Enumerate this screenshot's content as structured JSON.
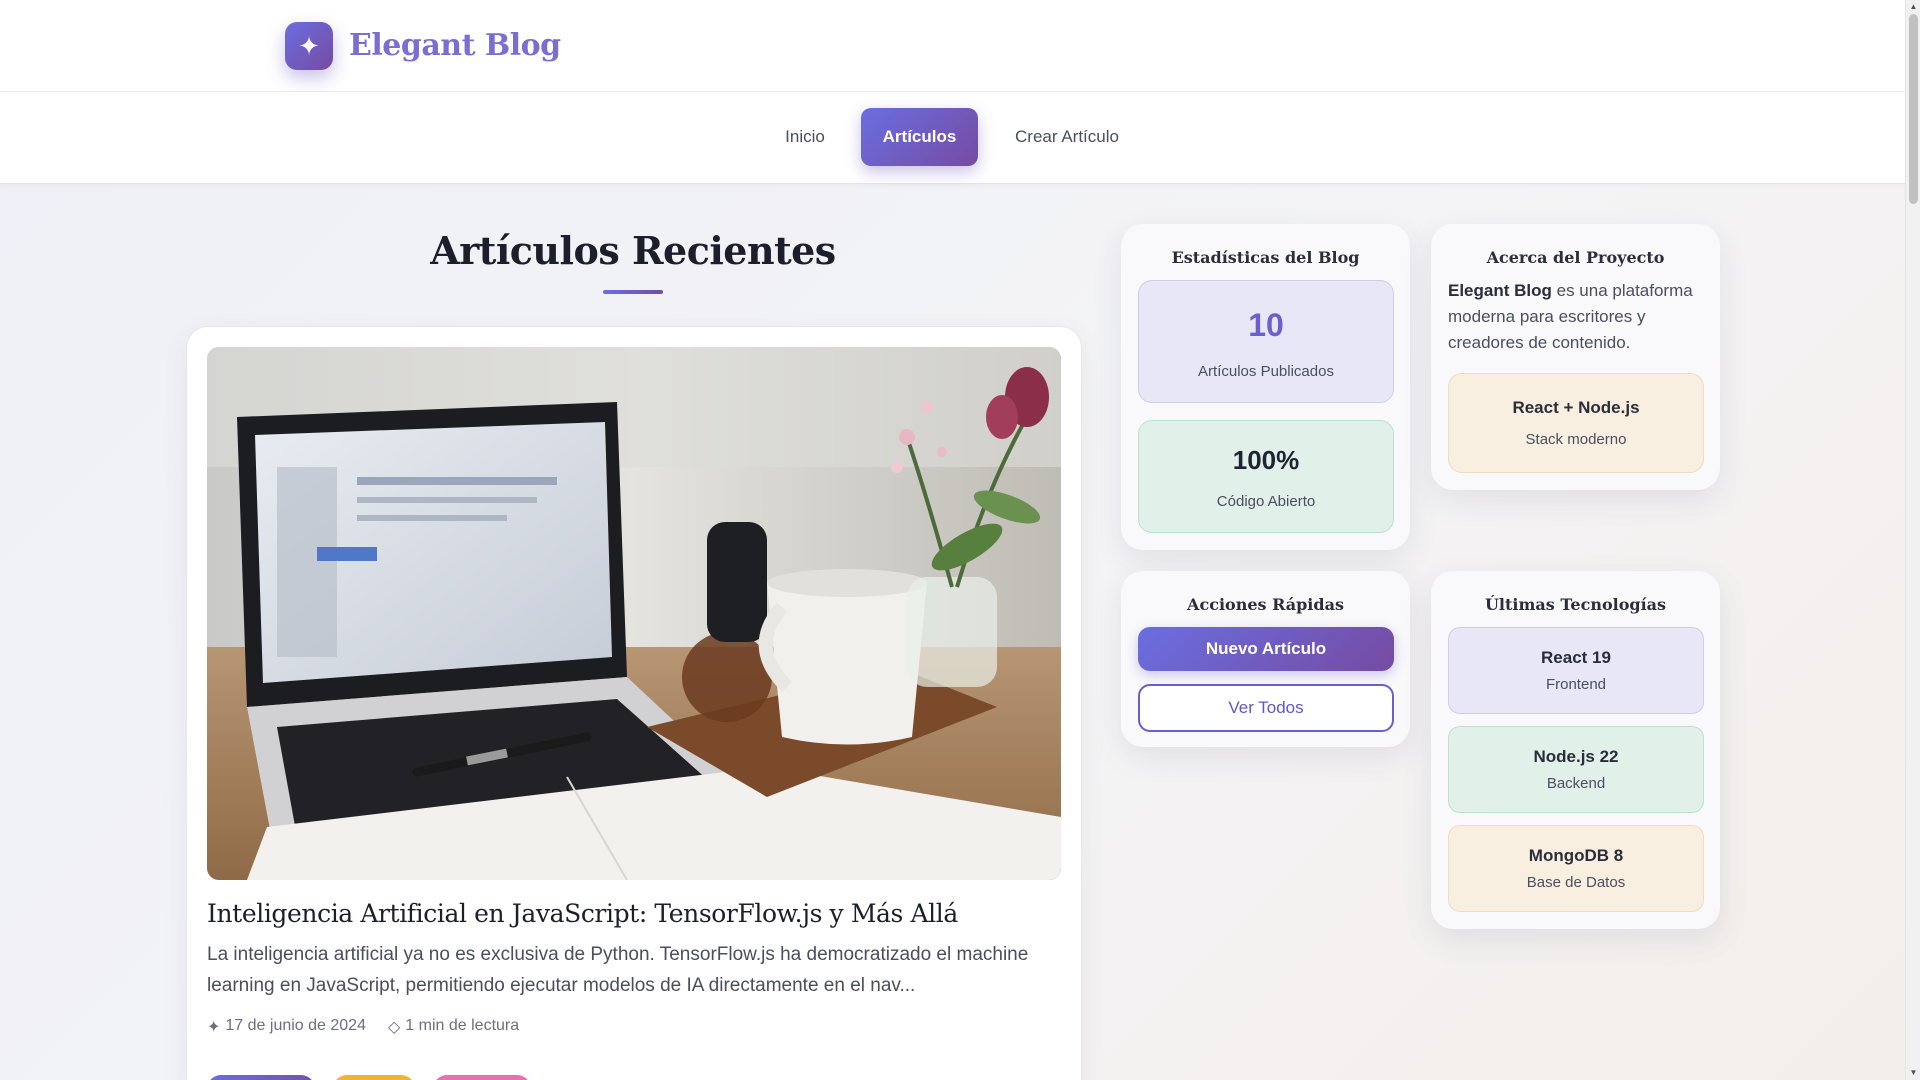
{
  "header": {
    "logo_icon": "sparkle-icon",
    "logo_glyph": "✦",
    "brand": "Elegant Blog"
  },
  "nav": {
    "items": [
      {
        "label": "Inicio",
        "active": false
      },
      {
        "label": "Artículos",
        "active": true
      },
      {
        "label": "Crear Artículo",
        "active": false
      }
    ]
  },
  "main": {
    "section_title": "Artículos Recientes",
    "article": {
      "title": "Inteligencia Artificial en JavaScript: TensorFlow.js y Más Allá",
      "excerpt": "La inteligencia artificial ya no es exclusiva de Python. TensorFlow.js ha democratizado el machine learning en JavaScript, permitiendo ejecutar modelos de IA directamente en el nav...",
      "date_icon": "✦",
      "date": "17 de junio de 2024",
      "read_icon": "◇",
      "read_time": "1 min de lectura"
    }
  },
  "sidebar": {
    "stats": {
      "title": "Estadísticas del Blog",
      "articles_value": "10",
      "articles_label": "Artículos Publicados",
      "opensource_value": "100%",
      "opensource_label": "Código Abierto"
    },
    "about": {
      "title": "Acerca del Proyecto",
      "brand": "Elegant Blog",
      "text": " es una plataforma moderna para escritores y creadores de contenido.",
      "stack_name": "React + Node.js",
      "stack_label": "Stack moderno"
    },
    "actions": {
      "title": "Acciones Rápidas",
      "new_article": "Nuevo Artículo",
      "view_all": "Ver Todos"
    },
    "tech": {
      "title": "Últimas Tecnologías",
      "items": [
        {
          "name": "React 19",
          "role": "Frontend"
        },
        {
          "name": "Node.js 22",
          "role": "Backend"
        },
        {
          "name": "MongoDB 8",
          "role": "Base de Datos"
        }
      ]
    }
  },
  "colors": {
    "accent_start": "#6a6ee0",
    "accent_end": "#764ba2",
    "brand_text": "#7b6dd1",
    "stat_number": "#6b5fcf"
  }
}
